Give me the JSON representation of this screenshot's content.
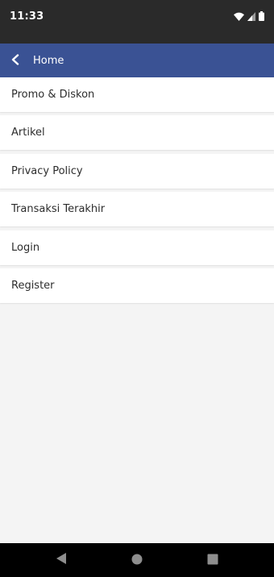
{
  "status_bar": {
    "time": "11:33",
    "icons": [
      "wifi-icon",
      "signal-icon",
      "battery-icon"
    ]
  },
  "app_bar": {
    "title": "Home",
    "back_icon": "chevron-left-icon",
    "background": "#3a5294"
  },
  "menu": {
    "items": [
      {
        "label": "Promo & Diskon"
      },
      {
        "label": "Artikel"
      },
      {
        "label": "Privacy Policy"
      },
      {
        "label": "Transaksi Terakhir"
      },
      {
        "label": "Login"
      },
      {
        "label": "Register"
      }
    ]
  },
  "nav_bar": {
    "buttons": [
      "back-triangle-icon",
      "home-circle-icon",
      "recents-square-icon"
    ]
  }
}
